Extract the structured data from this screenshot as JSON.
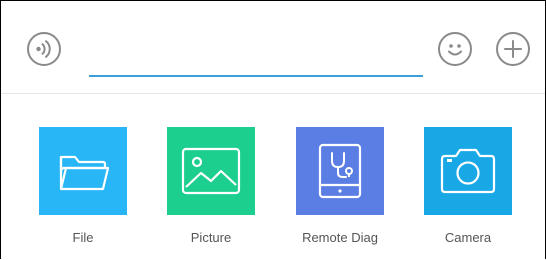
{
  "input_bar": {
    "voice_button_icon": "voice-icon",
    "text_input_value": "",
    "emoji_button_icon": "smiley-icon",
    "plus_button_icon": "plus-icon",
    "accent_color": "#3aa0d6"
  },
  "attachments": [
    {
      "label": "File",
      "icon": "folder-icon",
      "color": "#29b6f6"
    },
    {
      "label": "Picture",
      "icon": "image-icon",
      "color": "#1ccf8f"
    },
    {
      "label": "Remote Diag",
      "icon": "stethoscope-tablet-icon",
      "color": "#5b7ee5"
    },
    {
      "label": "Camera",
      "icon": "camera-icon",
      "color": "#18a8e6"
    }
  ]
}
